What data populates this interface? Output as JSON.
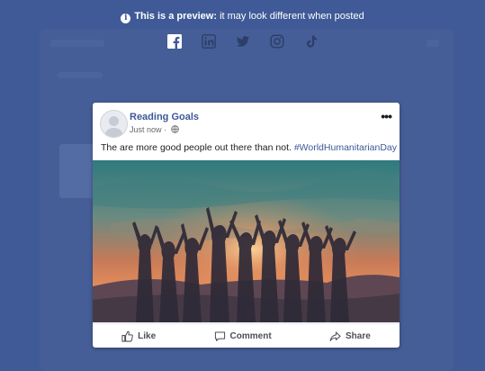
{
  "preview": {
    "bold": "This is a preview:",
    "rest": " it may look different when posted"
  },
  "platforms": [
    "facebook-icon",
    "linkedin-icon",
    "twitter-icon",
    "instagram-icon",
    "tiktok-icon"
  ],
  "post": {
    "page_name": "Reading Goals",
    "time": "Just now · ",
    "text": "The are more good people out there than not. ",
    "hashtag": "#WorldHumanitarianDay"
  },
  "actions": {
    "like": "Like",
    "comment": "Comment",
    "share": "Share"
  },
  "colors": {
    "background": "#3f5a96",
    "link": "#3b5998"
  }
}
